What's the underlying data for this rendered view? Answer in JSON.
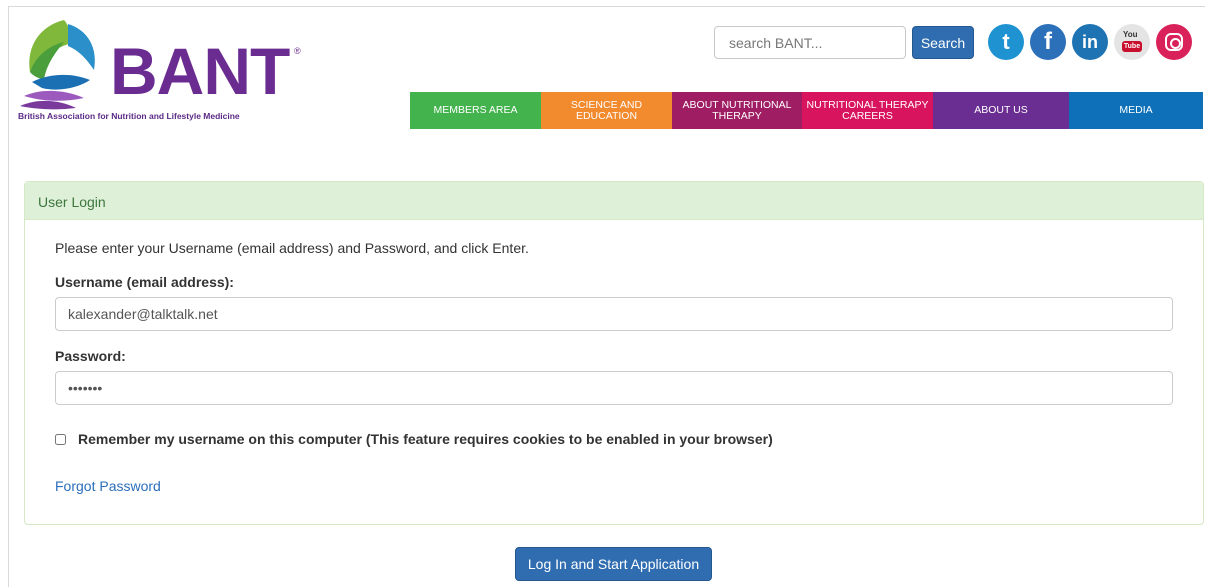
{
  "brand": {
    "name": "BANT",
    "reg_mark": "®",
    "tagline": "British Association for Nutrition and Lifestyle Medicine"
  },
  "search": {
    "placeholder": "search BANT...",
    "button_label": "Search"
  },
  "social": [
    {
      "name": "twitter-icon",
      "glyph": "t"
    },
    {
      "name": "facebook-icon",
      "glyph": "f"
    },
    {
      "name": "linkedin-icon",
      "glyph": "in"
    },
    {
      "name": "youtube-icon",
      "you": "You",
      "tube": "Tube"
    },
    {
      "name": "instagram-icon"
    }
  ],
  "nav": [
    {
      "label": "MEMBERS AREA",
      "color": "#42b34d"
    },
    {
      "label": "SCIENCE AND EDUCATION",
      "color": "#f28a2e"
    },
    {
      "label": "ABOUT NUTRITIONAL THERAPY",
      "color": "#9e1d63"
    },
    {
      "label": "NUTRITIONAL THERAPY CAREERS",
      "color": "#d8145e"
    },
    {
      "label": "ABOUT US",
      "color": "#6a2d91"
    },
    {
      "label": "MEDIA",
      "color": "#0d70b8"
    }
  ],
  "login": {
    "heading": "User Login",
    "intro": "Please enter your Username (email address) and Password, and click Enter.",
    "username_label": "Username (email address):",
    "username_value": "kalexander@talktalk.net",
    "password_label": "Password:",
    "password_value": "•••••••",
    "remember_label": "Remember my username on this computer (This feature requires cookies to be enabled in your browser)",
    "remember_checked": false,
    "forgot_label": "Forgot Password",
    "submit_label": "Log In and Start Application"
  },
  "colors": {
    "accent": "#2f6db0",
    "panel_heading_bg": "#dff0d8",
    "panel_heading_text": "#3c763d",
    "brand_purple": "#6b2c91"
  }
}
